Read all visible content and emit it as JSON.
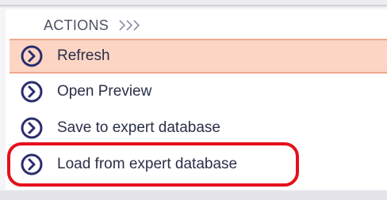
{
  "panel": {
    "header": {
      "label": "ACTIONS",
      "chevron_icon": "triple-chevron-right-icon"
    },
    "items": [
      {
        "label": "Refresh",
        "icon": "circle-chevron-right-icon",
        "highlighted": true
      },
      {
        "label": "Open Preview",
        "icon": "circle-chevron-right-icon",
        "highlighted": false
      },
      {
        "label": "Save to expert database",
        "icon": "circle-chevron-right-icon",
        "highlighted": false
      },
      {
        "label": "Load from expert database",
        "icon": "circle-chevron-right-icon",
        "highlighted": false,
        "annotated": true
      }
    ]
  },
  "colors": {
    "highlight_bg": "#fcd5c4",
    "highlight_border": "#f0a88c",
    "icon_color": "#2a2d6e",
    "annotation_red": "#e5101b",
    "text_color": "#2b2f47"
  }
}
